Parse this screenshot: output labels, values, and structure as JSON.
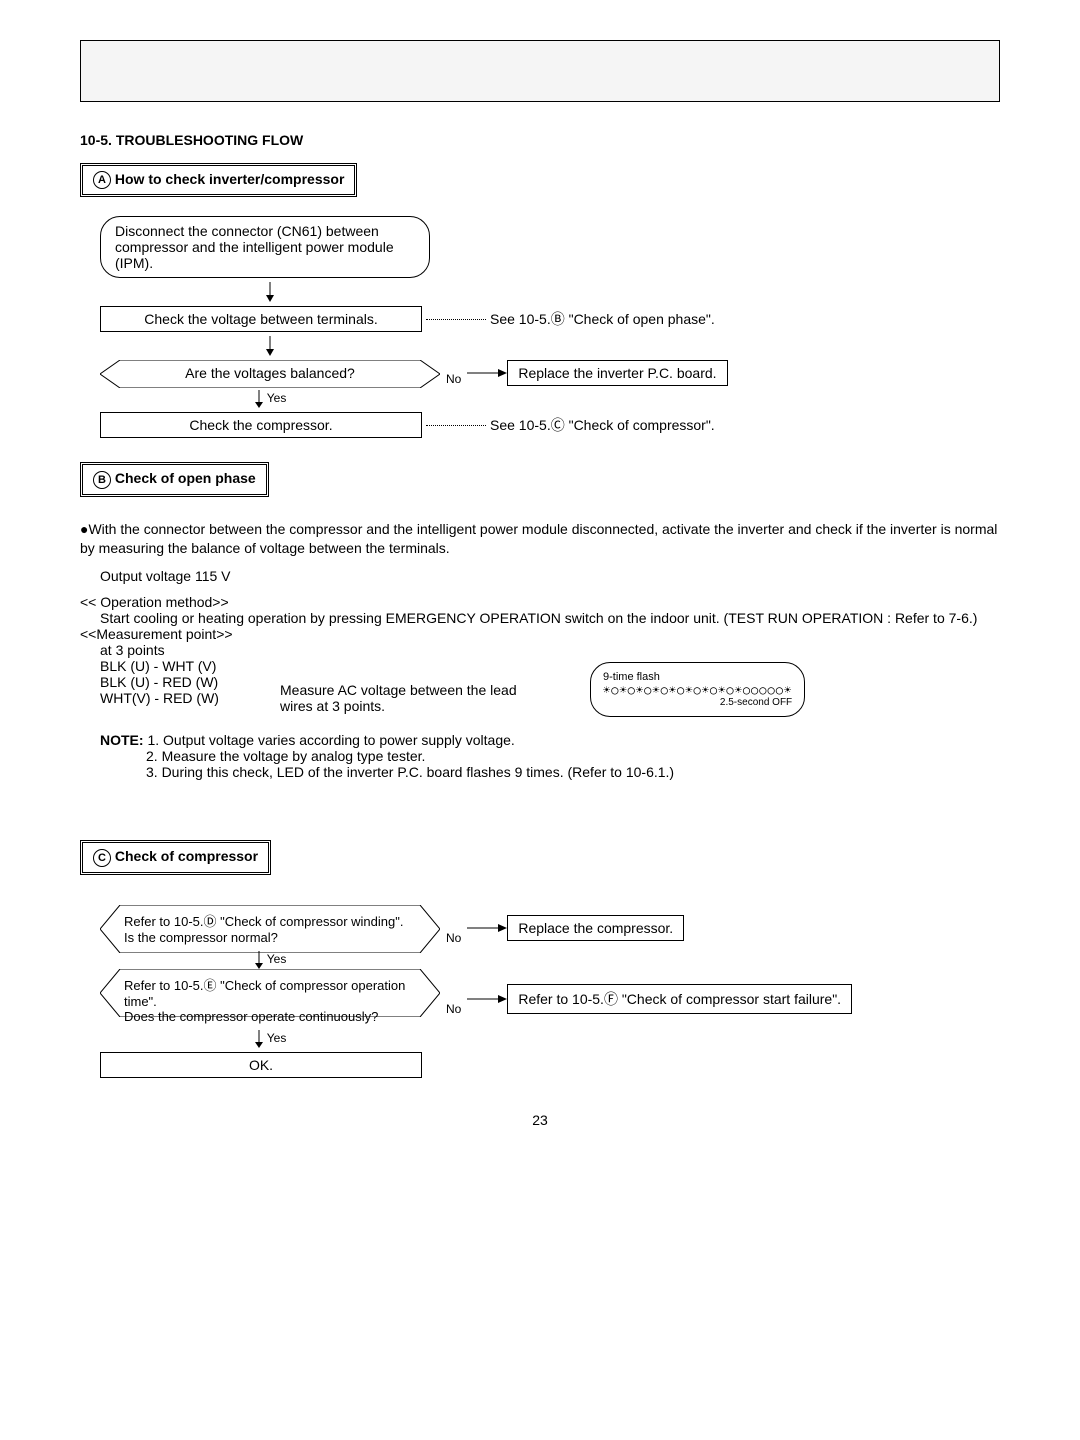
{
  "section_number": "10-5.",
  "section_title": "TROUBLESHOOTING FLOW",
  "flowA": {
    "label": "A",
    "title": "How to check inverter/compressor",
    "step1": "Disconnect the connector (CN61) between compressor and the intelligent power module (IPM).",
    "step2": "Check the voltage between terminals.",
    "step2_ref": "See 10-5.Ⓑ \"Check of open phase\".",
    "decision": "Are the voltages balanced?",
    "decision_yes": "Yes",
    "decision_no": "No",
    "decision_no_action": "Replace the inverter P.C. board.",
    "step3": "Check the compressor.",
    "step3_ref": "See 10-5.Ⓒ \"Check of compressor\"."
  },
  "flowB": {
    "label": "B",
    "title": "Check of open phase",
    "intro": "●With the connector between the compressor and the intelligent power module disconnected, activate the inverter and check if the inverter is normal by measuring the balance of voltage between the terminals.",
    "output_voltage": "Output voltage 115 V",
    "op_method_header": "<< Operation method>>",
    "op_method_text": "Start cooling or heating operation by pressing EMERGENCY OPERATION switch on the indoor unit. (TEST RUN OPERATION : Refer to 7-6.)",
    "meas_header": "<<Measurement point>>",
    "meas_at": "at 3 points",
    "meas1": "BLK (U) - WHT (V)",
    "meas2": "BLK (U) - RED (W)",
    "meas3": "WHT(V) - RED (W)",
    "meas_note": "Measure AC voltage between the lead wires at 3 points.",
    "flash_label": "9-time flash",
    "flash_off": "2.5-second OFF",
    "note_label": "NOTE:",
    "note1": "1. Output voltage varies according to power supply voltage.",
    "note2": "2. Measure the voltage by analog type tester.",
    "note3": "3. During this check, LED of the inverter P.C. board flashes 9 times. (Refer to 10-6.1.)"
  },
  "flowC": {
    "label": "C",
    "title": "Check of compressor",
    "dec1_line1": "Refer to 10-5.Ⓓ \"Check of compressor winding\".",
    "dec1_line2": "Is the compressor normal?",
    "dec1_yes": "Yes",
    "dec1_no": "No",
    "dec1_no_action": "Replace the compressor.",
    "dec2_line1": "Refer to 10-5.Ⓔ \"Check of compressor operation time\".",
    "dec2_line2": "Does the compressor operate continuously?",
    "dec2_yes": "Yes",
    "dec2_no": "No",
    "dec2_no_action": "Refer to 10-5.Ⓕ \"Check of compressor start failure\".",
    "ok": "OK."
  },
  "page_number": "23",
  "chart_data": {
    "type": "flowchart",
    "flows": [
      {
        "id": "A",
        "title": "How to check inverter/compressor",
        "nodes": [
          {
            "id": "A1",
            "type": "process",
            "text": "Disconnect the connector (CN61) between compressor and the intelligent power module (IPM)."
          },
          {
            "id": "A2",
            "type": "process",
            "text": "Check the voltage between terminals.",
            "ref": "See 10-5.B Check of open phase"
          },
          {
            "id": "A3",
            "type": "decision",
            "text": "Are the voltages balanced?"
          },
          {
            "id": "A3n",
            "type": "process",
            "text": "Replace the inverter P.C. board."
          },
          {
            "id": "A4",
            "type": "process",
            "text": "Check the compressor.",
            "ref": "See 10-5.C Check of compressor"
          }
        ],
        "edges": [
          {
            "from": "A1",
            "to": "A2"
          },
          {
            "from": "A2",
            "to": "A3"
          },
          {
            "from": "A3",
            "to": "A3n",
            "label": "No"
          },
          {
            "from": "A3",
            "to": "A4",
            "label": "Yes"
          }
        ]
      },
      {
        "id": "C",
        "title": "Check of compressor",
        "nodes": [
          {
            "id": "C1",
            "type": "decision",
            "text": "Refer to 10-5.D Check of compressor winding. Is the compressor normal?"
          },
          {
            "id": "C1n",
            "type": "process",
            "text": "Replace the compressor."
          },
          {
            "id": "C2",
            "type": "decision",
            "text": "Refer to 10-5.E Check of compressor operation time. Does the compressor operate continuously?"
          },
          {
            "id": "C2n",
            "type": "process",
            "text": "Refer to 10-5.F Check of compressor start failure."
          },
          {
            "id": "C3",
            "type": "terminal",
            "text": "OK."
          }
        ],
        "edges": [
          {
            "from": "C1",
            "to": "C1n",
            "label": "No"
          },
          {
            "from": "C1",
            "to": "C2",
            "label": "Yes"
          },
          {
            "from": "C2",
            "to": "C2n",
            "label": "No"
          },
          {
            "from": "C2",
            "to": "C3",
            "label": "Yes"
          }
        ]
      }
    ]
  }
}
